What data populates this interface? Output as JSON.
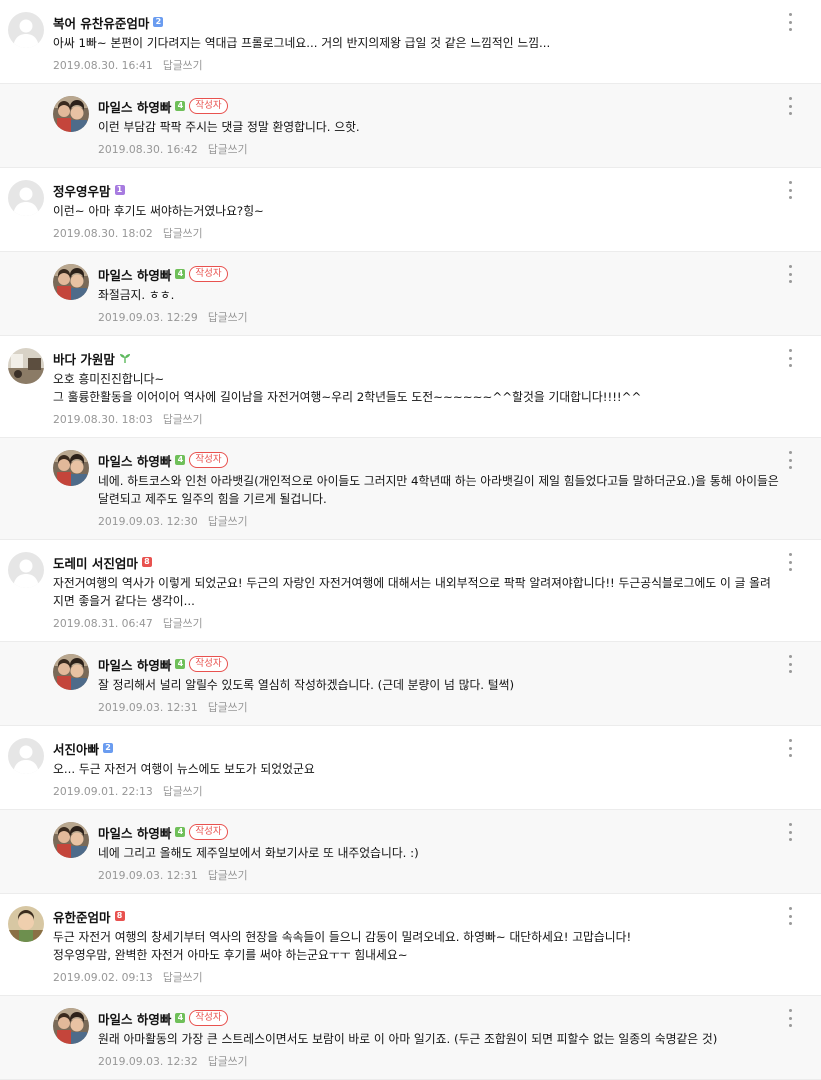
{
  "comments": [
    {
      "kind": "top",
      "avatar": "default",
      "nick": "복어 유찬유준엄마",
      "level": "2",
      "level_color": "#6a9cf0",
      "text": "아싸 1빠~ 본편이 기다려지는 역대급 프롤로그네요... 거의 반지의제왕 급일 것 같은 느낌적인 느낌...",
      "date": "2019.08.30. 16:41",
      "reply": "답글쓰기"
    },
    {
      "kind": "reply",
      "avatar": "photo-family",
      "nick": "마일스 하영빠",
      "level": "4",
      "level_color": "#6fbf59",
      "badge": "작성자",
      "text": "이런 부담감 팍팍 주시는 댓글 정말 환영합니다. 으핫.",
      "date": "2019.08.30. 16:42",
      "reply": "답글쓰기"
    },
    {
      "kind": "top",
      "avatar": "default",
      "nick": "정우영우맘",
      "level": "1",
      "level_color": "#a77be0",
      "text": "이런~ 아마 후기도 써야하는거였나요?힝~",
      "date": "2019.08.30. 18:02",
      "reply": "답글쓰기"
    },
    {
      "kind": "reply",
      "avatar": "photo-family",
      "nick": "마일스 하영빠",
      "level": "4",
      "level_color": "#6fbf59",
      "badge": "작성자",
      "text": "좌절금지. ㅎㅎ.",
      "date": "2019.09.03. 12:29",
      "reply": "답글쓰기"
    },
    {
      "kind": "top",
      "avatar": "photo-room",
      "nick": "바다 가원맘",
      "level": "sprout",
      "level_color": "#5cb85c",
      "text": "오호 흥미진진합니다~\n그 훌륭한활동을 이어이어 역사에 길이남을 자전거여행~우리 2학년들도 도전~~~~~~^^할것을 기대합니다!!!!^^",
      "date": "2019.08.30. 18:03",
      "reply": "답글쓰기"
    },
    {
      "kind": "reply",
      "avatar": "photo-family",
      "nick": "마일스 하영빠",
      "level": "4",
      "level_color": "#6fbf59",
      "badge": "작성자",
      "text": "네에. 하트코스와 인천 아라뱃길(개인적으로 아이들도 그러지만 4학년때 하는 아라뱃길이 제일 힘들었다고들 말하더군요.)을 통해 아이들은 달련되고 제주도 일주의 힘을 기르게 될겁니다.",
      "date": "2019.09.03. 12:30",
      "reply": "답글쓰기"
    },
    {
      "kind": "top",
      "avatar": "default",
      "nick": "도레미 서진엄마",
      "level": "8",
      "level_color": "#e8524f",
      "text": "자전거여행의 역사가 이렇게 되었군요! 두근의 자랑인 자전거여행에 대해서는 내외부적으로 팍팍 알려져야합니다!! 두근공식블로그에도 이 글 올려지면 좋을거 같다는 생각이...",
      "date": "2019.08.31. 06:47",
      "reply": "답글쓰기"
    },
    {
      "kind": "reply",
      "avatar": "photo-family",
      "nick": "마일스 하영빠",
      "level": "4",
      "level_color": "#6fbf59",
      "badge": "작성자",
      "text": "잘 정리해서 널리 알릴수 있도록 열심히 작성하겠습니다. (근데 분량이 넘 많다. 털썩)",
      "date": "2019.09.03. 12:31",
      "reply": "답글쓰기"
    },
    {
      "kind": "top",
      "avatar": "default",
      "nick": "서진아빠",
      "level": "2",
      "level_color": "#6a9cf0",
      "text": "오... 두근 자전거 여행이 뉴스에도 보도가 되었었군요",
      "date": "2019.09.01. 22:13",
      "reply": "답글쓰기"
    },
    {
      "kind": "reply",
      "avatar": "photo-family",
      "nick": "마일스 하영빠",
      "level": "4",
      "level_color": "#6fbf59",
      "badge": "작성자",
      "text": "네에 그리고 올해도 제주일보에서 화보기사로 또 내주었습니다. :)",
      "date": "2019.09.03. 12:31",
      "reply": "답글쓰기"
    },
    {
      "kind": "top",
      "avatar": "photo-child",
      "nick": "유한준엄마",
      "level": "8",
      "level_color": "#e8524f",
      "text": "두근 자전거 여행의 창세기부터 역사의 현장을 속속들이 들으니 감동이 밀려오네요. 하영빠~ 대단하세요! 고맙습니다!\n정우영우맘, 완벽한 자전거 아마도 후기를 써야 하는군요ㅜㅜ 힘내세요~",
      "date": "2019.09.02. 09:13",
      "reply": "답글쓰기"
    },
    {
      "kind": "reply",
      "avatar": "photo-family",
      "nick": "마일스 하영빠",
      "level": "4",
      "level_color": "#6fbf59",
      "badge": "작성자",
      "text": "원래 아마활동의 가장 큰 스트레스이면서도 보람이 바로 이 아마 일기죠. (두근 조합원이 되면 피할수 없는 일종의 숙명같은 것)",
      "date": "2019.09.03. 12:32",
      "reply": "답글쓰기"
    }
  ]
}
